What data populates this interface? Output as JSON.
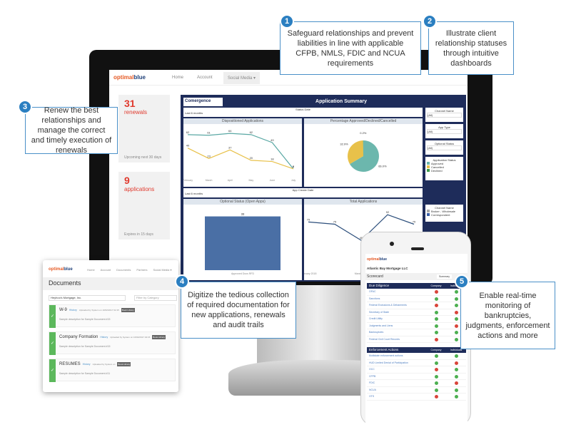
{
  "callouts": [
    {
      "number": "1",
      "text": "Safeguard relationships and prevent liabilities in line with applicable CFPB, NMLS, FDIC and NCUA requirements"
    },
    {
      "number": "2",
      "text": "Illustrate client relationship statuses through intuitive dashboards"
    },
    {
      "number": "3",
      "text": "Renew the best relationships and manage the correct and timely execution of renewals"
    },
    {
      "number": "4",
      "text": "Digitize the tedious collection of required documentation for new applications, renewals and audit trails"
    },
    {
      "number": "5",
      "text": "Enable real-time monitoring of bankruptcies, judgments, enforcement actions and more"
    }
  ],
  "brand": {
    "optimal": "optimal",
    "blue": "blue",
    "accent": "#e55a25",
    "navy": "#1e3f78"
  },
  "desktop": {
    "nav": [
      "Home",
      "Account",
      "Social Media ▾"
    ],
    "cards": [
      {
        "count": "31",
        "label": "renewals",
        "note": "Upcoming next 30 days"
      },
      {
        "count": "9",
        "label": "applications",
        "note": "Expires in 15 days"
      }
    ],
    "dashboard": {
      "brand": "Comergence",
      "title": "Application Summary",
      "filter1_label": "Status Date",
      "filter1_value": "Last 6 months",
      "filter2_label": "App Create Date",
      "filter2_value": "Last 6 months",
      "side_filters": [
        {
          "label": "Channel Name",
          "value": "(All)"
        },
        {
          "label": "App Type",
          "value": "(All)"
        },
        {
          "label": "Optional Status",
          "value": "(All)"
        }
      ],
      "status_legend": {
        "title": "Application Status",
        "items": [
          {
            "label": "Approved",
            "color": "#6cb7ad"
          },
          {
            "label": "Cancelled",
            "color": "#e8c14a"
          },
          {
            "label": "Declined",
            "color": "#3c9a4a"
          }
        ]
      },
      "channel_legend": {
        "title": "Channel Name",
        "items": [
          {
            "label": "Broker - Wholesale",
            "color": "#aaaaaa"
          },
          {
            "label": "Correspondent",
            "color": "#3a5fa8"
          }
        ]
      },
      "chart_titles": [
        "Dispositioned Applications",
        "Percentage Approved/Declined/Cancelled",
        "Optional Status (Open Apps)",
        "Total Applications"
      ]
    }
  },
  "chart_data": [
    {
      "type": "line",
      "title": "Dispositioned Applications",
      "categories": [
        "February",
        "March",
        "April",
        "May",
        "June",
        "July"
      ],
      "series": [
        {
          "color": "#5aa8a4",
          "values": [
            62,
            61,
            64,
            62,
            49,
            6
          ]
        },
        {
          "color": "#e8c14a",
          "values": [
            40,
            23,
            37,
            20,
            18,
            6
          ]
        }
      ]
    },
    {
      "type": "pie",
      "title": "Percentage Approved/Declined/Cancelled",
      "values": [
        66.0,
        32.9,
        0.2
      ],
      "labels": [
        "66.0%",
        "32.9%",
        "0.2%"
      ],
      "colors": [
        "#6cb7ad",
        "#e8c14a",
        "#3c9a4a"
      ]
    },
    {
      "type": "bar",
      "title": "Optional Status (Open Apps)",
      "categories": [
        "Approved Docs RFD"
      ],
      "values": [
        33
      ],
      "color": "#4a6fa5"
    },
    {
      "type": "line",
      "title": "Total Applications",
      "categories": [
        "February 2018",
        "March 2018",
        "April 2018"
      ],
      "series": [
        {
          "color": "#2d4f7c",
          "values": [
            79,
            75,
            46,
            92,
            75
          ]
        }
      ]
    }
  ],
  "tablet": {
    "nav": [
      "Home",
      "Account",
      "Documents",
      "Partners",
      "Social Media ▾"
    ],
    "title": "Documents",
    "company": "Heyhoo's Mortgage, Inc.",
    "filter_placeholder": "Filter by Category",
    "docs": [
      {
        "name": "W-9",
        "link": "History",
        "meta": "Uploaded by System on 10/02/2017 02:15",
        "badge": "Book Library",
        "desc": "Sample description for Sample Document #15"
      },
      {
        "name": "Company Formation",
        "link": "History",
        "meta": "Uploaded by System on 10/02/2017 02:15",
        "badge": "Book Library",
        "desc": "Sample description for Sample Document #15"
      },
      {
        "name": "RESUMES",
        "link": "History",
        "meta": "Uploaded by System on",
        "badge": "Book Library",
        "desc": "Sample description for Sample Document #11"
      }
    ]
  },
  "phone": {
    "company": "Atlantic Bay Mortgage LLC",
    "title": "Scorecard",
    "tab": "Summary",
    "sections": [
      {
        "title": "Due Diligence",
        "cols": [
          "Company",
          "Individuals"
        ],
        "rows": [
          {
            "label": "OFAC",
            "c": "red",
            "i": "green"
          },
          {
            "label": "Sanctions",
            "c": "green",
            "i": "green"
          },
          {
            "label": "Federal Exclusions & Debarments",
            "c": "red",
            "i": "green"
          },
          {
            "label": "Secretary of State",
            "c": "green",
            "i": "red"
          },
          {
            "label": "Credit Utility",
            "c": "green",
            "i": "green"
          },
          {
            "label": "Judgments and Liens",
            "c": "green",
            "i": "red"
          },
          {
            "label": "Bankruptcies",
            "c": "green",
            "i": "green"
          },
          {
            "label": "Federal Civil Court Records",
            "c": "red",
            "i": "green"
          }
        ]
      },
      {
        "title": "Enforcement Actions",
        "cols": [
          "Company",
          "Individuals"
        ],
        "rows": [
          {
            "label": "Multistate enforcement actions",
            "c": "green",
            "i": "green"
          },
          {
            "label": "HUD Limited Denial of Participation",
            "c": "green",
            "i": "red"
          },
          {
            "label": "OCC",
            "c": "red",
            "i": "green"
          },
          {
            "label": "CFPB",
            "c": "green",
            "i": "green"
          },
          {
            "label": "FDIC",
            "c": "green",
            "i": "red"
          },
          {
            "label": "NCUA",
            "c": "green",
            "i": "green"
          },
          {
            "label": "OTS",
            "c": "red",
            "i": "green"
          }
        ]
      }
    ]
  }
}
